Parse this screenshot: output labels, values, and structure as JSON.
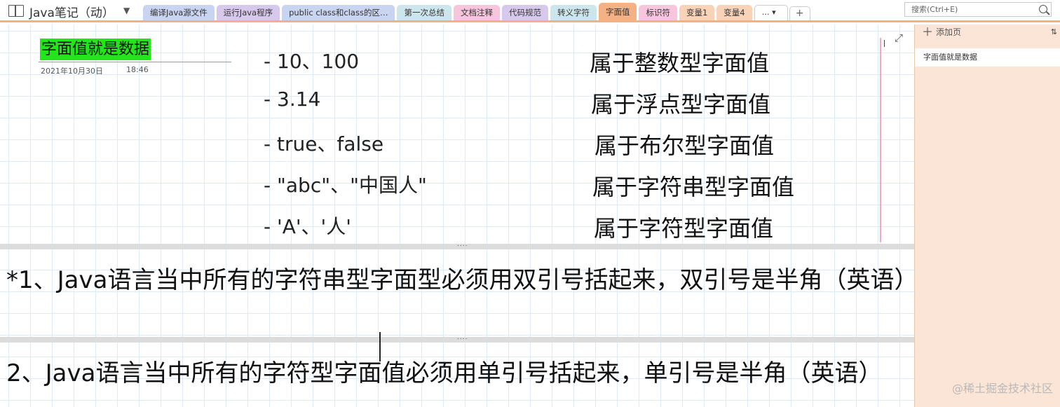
{
  "notebook": {
    "title": "Java笔记（动）",
    "dropdown_icon": "chevron-down-icon"
  },
  "tabs": [
    {
      "label": "编译Java源文件",
      "color": "#c9d5f0",
      "active": false
    },
    {
      "label": "运行Java程序",
      "color": "#d7c9ec",
      "active": false
    },
    {
      "label": "public class和class的区…",
      "color": "#c9d5f0",
      "active": false
    },
    {
      "label": "第一次总结",
      "color": "#cde6ec",
      "active": false
    },
    {
      "label": "文档注释",
      "color": "#f7c6dd",
      "active": false
    },
    {
      "label": "代码规范",
      "color": "#d7c9ec",
      "active": false
    },
    {
      "label": "转义字符",
      "color": "#cde6ec",
      "active": false
    },
    {
      "label": "字面值",
      "color": "#f4b183",
      "active": true
    },
    {
      "label": "标识符",
      "color": "#f7c6dd",
      "active": false
    },
    {
      "label": "变量1",
      "color": "#f8d3b8",
      "active": false
    },
    {
      "label": "变量4",
      "color": "#f8d3b8",
      "active": false
    }
  ],
  "tab_more_label": "… ▾",
  "tab_new_label": "+",
  "search": {
    "placeholder": "搜索(Ctrl+E)"
  },
  "page": {
    "title": "字面值就是数据",
    "date": "2021年10月30日",
    "time": "18:46",
    "literals": [
      {
        "example": "-  10、100",
        "category": "属于整数型字面值"
      },
      {
        "example": "-  3.14",
        "category": "属于浮点型字面值"
      },
      {
        "example": "-  true、false",
        "category": "属于布尔型字面值"
      },
      {
        "example": "-  \"abc\"、\"中国人\"",
        "category": "属于字符串型字面值"
      },
      {
        "example": "-  'A'、'人'",
        "category": "属于字符型字面值"
      }
    ],
    "divider_dots": "....",
    "note1": "*1、Java语言当中所有的字符串型字面型必须用双引号括起来，双引号是半角（英语）",
    "note2": "2、Java语言当中所有的字符型字面值必须用单引号括起来，单引号是半角（英语）"
  },
  "right_pane": {
    "add_page_label": "添加页",
    "pages": [
      "字面值就是数据"
    ],
    "watermark": "@稀土掘金技术社区"
  },
  "colors": {
    "accent": "#f4b183",
    "title_highlight": "#22e51a",
    "pane_bg": "#fbe5d6"
  }
}
